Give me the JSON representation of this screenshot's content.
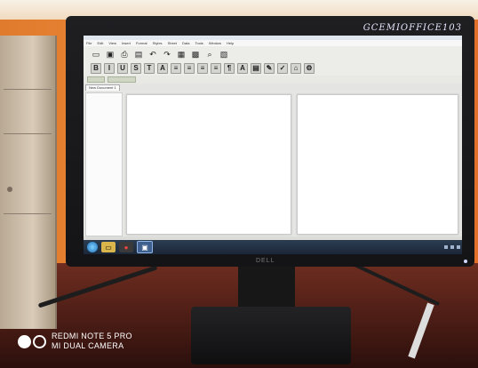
{
  "monitor": {
    "sticker_label": "GCEMIOFFICE103",
    "brand": "DELL"
  },
  "app": {
    "menu": [
      "File",
      "Edit",
      "View",
      "Insert",
      "Format",
      "Styles",
      "Sheet",
      "Data",
      "Tools",
      "Window",
      "Help"
    ],
    "toolbar1_icons": [
      "open-icon",
      "save-icon",
      "print-icon",
      "print-preview-icon",
      "undo-icon",
      "redo-icon",
      "table-icon",
      "grid-icon",
      "find-icon",
      "image-icon"
    ],
    "toolbar2_icons": [
      {
        "name": "bold-icon",
        "glyph": "B"
      },
      {
        "name": "italic-icon",
        "glyph": "I"
      },
      {
        "name": "underline-icon",
        "glyph": "U"
      },
      {
        "name": "strikethrough-icon",
        "glyph": "S"
      },
      {
        "name": "subscript-icon",
        "glyph": "T"
      },
      {
        "name": "superscript-icon",
        "glyph": "A"
      },
      {
        "name": "align-left-icon",
        "glyph": "≡"
      },
      {
        "name": "align-center-icon",
        "glyph": "≡"
      },
      {
        "name": "align-right-icon",
        "glyph": "≡"
      },
      {
        "name": "justify-icon",
        "glyph": "≡"
      },
      {
        "name": "paragraph-icon",
        "glyph": "¶"
      },
      {
        "name": "font-color-icon",
        "glyph": "A"
      },
      {
        "name": "highlight-icon",
        "glyph": "▤"
      },
      {
        "name": "pen-icon",
        "glyph": "✎"
      },
      {
        "name": "spellcheck-icon",
        "glyph": "✓"
      },
      {
        "name": "brush-icon",
        "glyph": "⌂"
      },
      {
        "name": "gear-icon",
        "glyph": "⚙"
      }
    ],
    "tab_label": "New Document 1"
  },
  "camera": {
    "line1": "REDMI NOTE 5 PRO",
    "line2": "MI DUAL CAMERA"
  },
  "colors": {
    "wall": "#ef8a3a",
    "bezel": "#1a1a1c",
    "taskbar": "#1f2d40"
  }
}
